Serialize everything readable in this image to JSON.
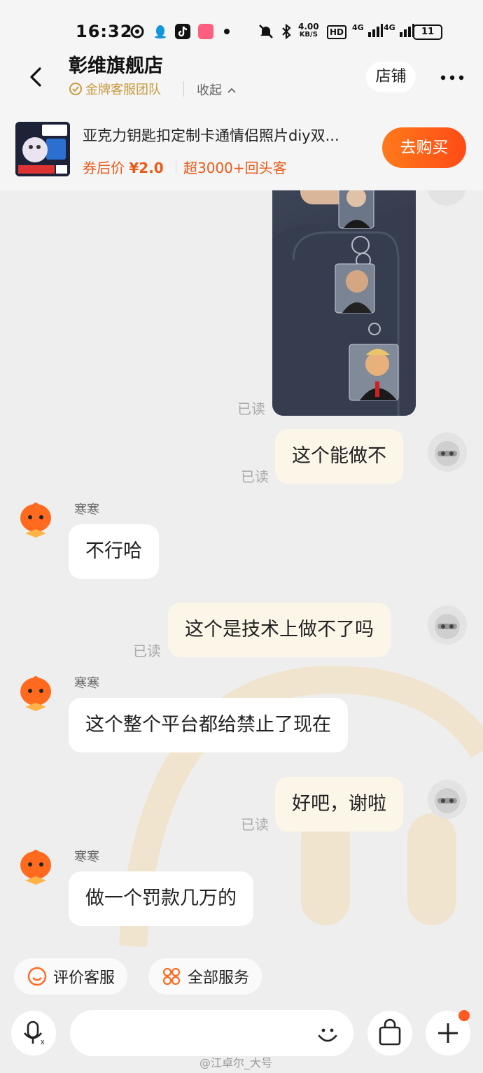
{
  "status_bar": {
    "time": "16:32",
    "net_speed": "4.00",
    "net_unit": "KB/S",
    "hd": "HD",
    "signal1": "4G",
    "signal2": "4G",
    "battery": "11"
  },
  "header": {
    "shop_name": "彰维旗舰店",
    "team_badge": "金牌客服团队",
    "collapse": "收起",
    "store_button": "店铺"
  },
  "product": {
    "title": "亚克力钥匙扣定制卡通情侣照片diy双...",
    "price_prefix": "券后价",
    "price": "¥2.0",
    "repeat": "超3000+回头客",
    "buy_button": "去购买"
  },
  "messages": [
    {
      "side": "me",
      "type": "image",
      "read": "已读"
    },
    {
      "side": "me",
      "type": "text",
      "text": "这个能做不",
      "read": "已读"
    },
    {
      "side": "them",
      "sender": "寒寒",
      "text": "不行哈"
    },
    {
      "side": "me",
      "type": "text",
      "text": "这个是技术上做不了吗",
      "read": "已读"
    },
    {
      "side": "them",
      "sender": "寒寒",
      "text": "这个整个平台都给禁止了现在"
    },
    {
      "side": "me",
      "type": "text",
      "text": "好吧，谢啦",
      "read": "已读"
    },
    {
      "side": "them",
      "sender": "寒寒",
      "text": "做一个罚款几万的"
    }
  ],
  "quick_actions": {
    "rate": "评价客服",
    "all_services": "全部服务"
  },
  "watermark": "@江卓尔_大号",
  "colors": {
    "accent": "#ff5a1f",
    "price": "#e85a18",
    "gold": "#c69a3c"
  }
}
